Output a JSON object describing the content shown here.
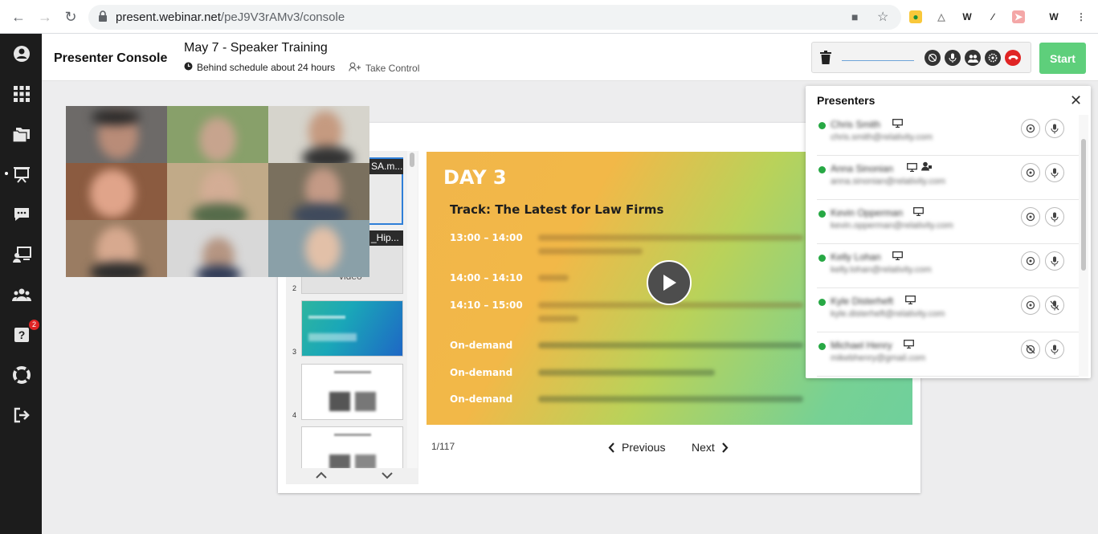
{
  "browser": {
    "url_host": "present.webinar.net",
    "url_path": "/peJ9V3rAMv3/console"
  },
  "sidebar": {
    "items": [
      {
        "icon": "user-icon"
      },
      {
        "icon": "grid-icon"
      },
      {
        "icon": "folders-icon"
      },
      {
        "icon": "presentation-icon"
      },
      {
        "icon": "chat-icon"
      },
      {
        "icon": "presenter-screen-icon"
      },
      {
        "icon": "people-icon"
      },
      {
        "icon": "question-icon",
        "badge": "2"
      },
      {
        "icon": "lifebuoy-icon"
      },
      {
        "icon": "sign-out-icon"
      }
    ]
  },
  "header": {
    "console_title": "Presenter Console",
    "event_title": "May 7 - Speaker Training",
    "schedule_status": "Behind schedule about 24 hours",
    "take_control": "Take Control",
    "start_label": "Start"
  },
  "thumbnails": {
    "label_1": "SA.m...",
    "label_2": "_Hip...",
    "label_2_sub": "video",
    "numbers": [
      "2",
      "3",
      "4"
    ]
  },
  "slide": {
    "day": "DAY 3",
    "track": "Track: The Latest for Law Firms",
    "times": [
      "13:00 – 14:00",
      "14:00 – 14:10",
      "14:10 – 15:00",
      "On-demand",
      "On-demand",
      "On-demand"
    ]
  },
  "pager": {
    "counter": "1/117",
    "previous": "Previous",
    "next": "Next"
  },
  "presenters": {
    "title": "Presenters",
    "list": [
      {
        "name": "Chris Smith",
        "email": "chris.smith@relativity.com",
        "mic_muted": false,
        "cam_off": false
      },
      {
        "name": "Anna Sinonian",
        "email": "anna.sinonian@relativity.com",
        "mic_muted": false,
        "cam_off": false
      },
      {
        "name": "Kevin Opperman",
        "email": "kevin.opperman@relativity.com",
        "mic_muted": false,
        "cam_off": false
      },
      {
        "name": "Kelly Lohan",
        "email": "kelly.lohan@relativity.com",
        "mic_muted": false,
        "cam_off": false
      },
      {
        "name": "Kyle Disterheft",
        "email": "kyle.disterheft@relativity.com",
        "mic_muted": true,
        "cam_off": false
      },
      {
        "name": "Michael Henry",
        "email": "mikebhenry@gmail.com",
        "mic_muted": false,
        "cam_off": true
      }
    ]
  },
  "colors": {
    "start": "#5ecf7b",
    "online": "#27a844",
    "hangup": "#e02424",
    "sidebar": "#1c1c1c"
  }
}
